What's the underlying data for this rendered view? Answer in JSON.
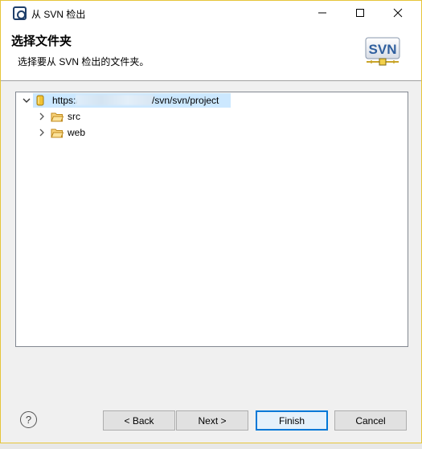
{
  "window": {
    "title": "从 SVN 检出"
  },
  "header": {
    "title": "选择文件夹",
    "description": "选择要从 SVN 检出的文件夹。",
    "logo_text": "SVN"
  },
  "tree": {
    "root": {
      "label_prefix": "https:/",
      "label_suffix": "/svn/svn/project",
      "icon": "repository-icon",
      "expanded": true,
      "selected": true
    },
    "children": [
      {
        "label": "src",
        "icon": "folder-icon",
        "expanded": false
      },
      {
        "label": "web",
        "icon": "folder-icon",
        "expanded": false
      }
    ]
  },
  "buttons": {
    "help": "?",
    "back": "< Back",
    "next": "Next >",
    "finish": "Finish",
    "cancel": "Cancel"
  },
  "colors": {
    "accent": "#0078d7",
    "selection": "#cce8ff",
    "folder": "#e8b64a",
    "window_border": "#e6c53a"
  }
}
